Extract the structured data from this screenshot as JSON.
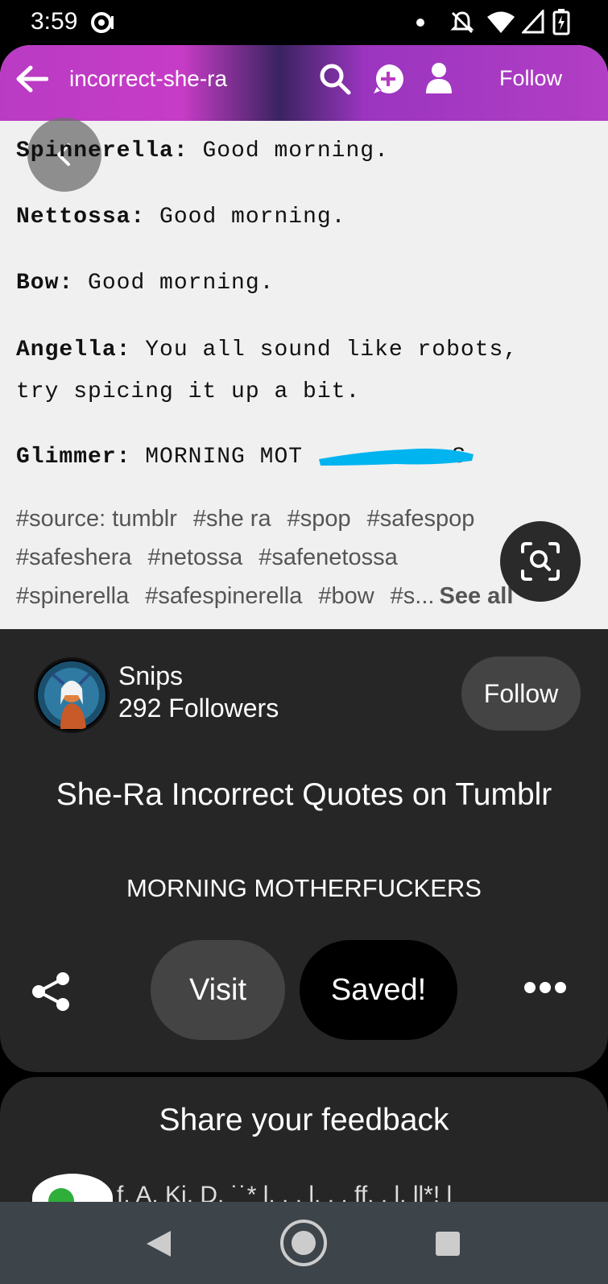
{
  "status_bar": {
    "time": "3:59",
    "icons": [
      "notification-dot-icon",
      "dnd-off-icon",
      "wifi-icon",
      "signal-icon",
      "battery-charging-icon"
    ]
  },
  "pin_image": {
    "tumblr_header": {
      "blog_name": "incorrect-she-ra",
      "follow_label": "Follow",
      "icons": [
        "back-arrow-icon",
        "search-icon",
        "add-message-icon",
        "user-icon"
      ]
    },
    "quote_lines": [
      {
        "speaker": "Spinnerella:",
        "text": "Good morning."
      },
      {
        "speaker": "Nettossa:",
        "text": "Good morning."
      },
      {
        "speaker": "Bow:",
        "text": "Good morning."
      },
      {
        "speaker": "Angella:",
        "text": "You all sound like robots,",
        "text2": "try spicing it up a bit."
      },
      {
        "speaker": "Glimmer:",
        "text": "MORNING MOT",
        "text_tail": "S"
      }
    ],
    "tags": {
      "row1": [
        "#source: tumblr",
        "#she ra",
        "#spop",
        "#safespop"
      ],
      "row2": [
        "#safeshera",
        "#netossa",
        "#safenetossa"
      ],
      "row3": [
        "#spinerella",
        "#safespinerella",
        "#bow",
        "#s..."
      ],
      "see_all": "See all"
    }
  },
  "creator": {
    "name": "Snips",
    "followers": "292 Followers",
    "follow_label": "Follow"
  },
  "pin": {
    "title": "She-Ra Incorrect Quotes on Tumblr",
    "description": "MORNING MOTHERFUCKERS",
    "visit_label": "Visit",
    "saved_label": "Saved!"
  },
  "feedback": {
    "title": "Share your feedback",
    "preview_text": "f. A. Ki. D. ˙˙* l. . . l. . . ff. . l. ll*! l"
  },
  "colors": {
    "card_bg": "#262626",
    "redaction": "#00b4f0",
    "tumblr_gradient": "#b93bc4"
  }
}
